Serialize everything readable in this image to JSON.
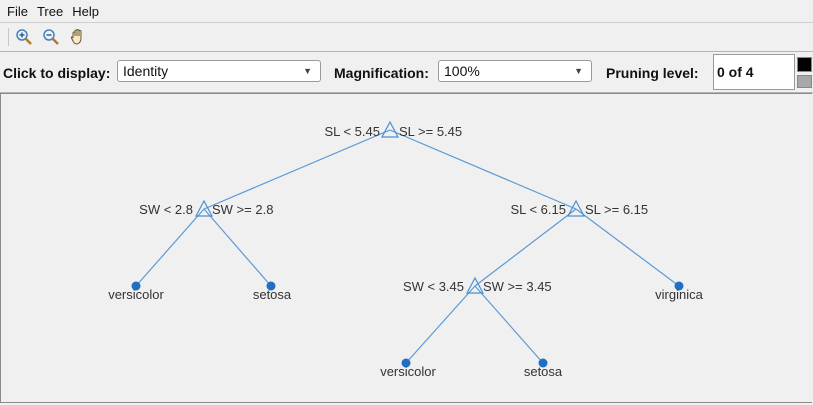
{
  "menu": {
    "file": "File",
    "tree": "Tree",
    "help": "Help"
  },
  "toolbar": {
    "icons": [
      "zoom-in-icon",
      "zoom-out-icon",
      "pan-hand-icon"
    ]
  },
  "controls": {
    "display_label": "Click to display:",
    "display_value": "Identity",
    "magnification_label": "Magnification:",
    "magnification_value": "100%",
    "pruning_label": "Pruning level:",
    "pruning_value": "0 of 4"
  },
  "colors": {
    "node": "#4a8fd4",
    "leaf": "#1f6fc2",
    "edge": "#5a9ad6"
  },
  "tree": {
    "nodes": {
      "root": {
        "left_rule": "SL < 5.45",
        "right_rule": "SL >= 5.45"
      },
      "n_left": {
        "left_rule": "SW < 2.8",
        "right_rule": "SW >= 2.8"
      },
      "n_right": {
        "left_rule": "SL < 6.15",
        "right_rule": "SL >= 6.15"
      },
      "n_rl": {
        "left_rule": "SW < 3.45",
        "right_rule": "SW >= 3.45"
      }
    },
    "leaves": {
      "l1": "versicolor",
      "l2": "setosa",
      "l3": "virginica",
      "l4": "versicolor",
      "l5": "setosa"
    }
  }
}
